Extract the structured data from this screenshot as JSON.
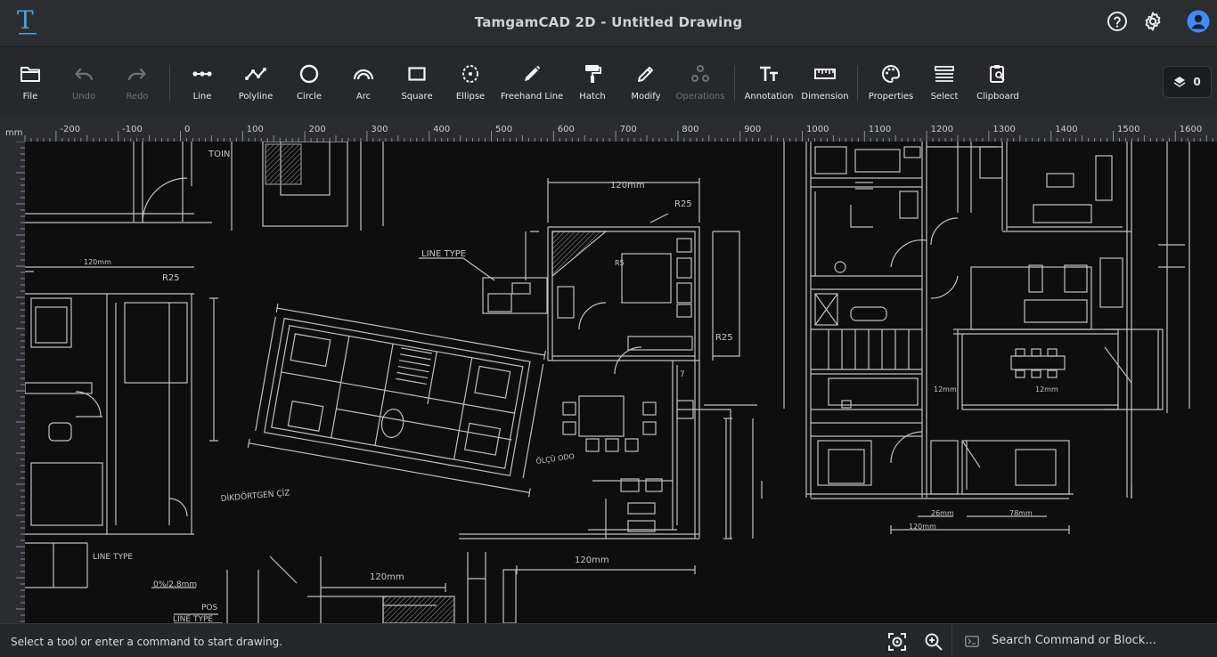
{
  "app": {
    "title": "TamgamCAD 2D - Untitled Drawing",
    "logo_letter": "T"
  },
  "toolbar": {
    "tools": [
      {
        "id": "file",
        "label": "File"
      },
      {
        "id": "undo",
        "label": "Undo"
      },
      {
        "id": "redo",
        "label": "Redo"
      },
      {
        "id": "line",
        "label": "Line"
      },
      {
        "id": "polyline",
        "label": "Polyline"
      },
      {
        "id": "circle",
        "label": "Circle"
      },
      {
        "id": "arc",
        "label": "Arc"
      },
      {
        "id": "square",
        "label": "Square"
      },
      {
        "id": "ellipse",
        "label": "Ellipse"
      },
      {
        "id": "freehand",
        "label": "Freehand Line"
      },
      {
        "id": "hatch",
        "label": "Hatch"
      },
      {
        "id": "modify",
        "label": "Modify"
      },
      {
        "id": "operations",
        "label": "Operations"
      },
      {
        "id": "annotation",
        "label": "Annotation"
      },
      {
        "id": "dimension",
        "label": "Dimension"
      },
      {
        "id": "properties",
        "label": "Properties"
      },
      {
        "id": "select",
        "label": "Select"
      },
      {
        "id": "clipboard",
        "label": "Clipboard"
      }
    ],
    "layer_count": "0"
  },
  "ruler": {
    "unit": "mm",
    "ticks": [
      "-200",
      "-100",
      "0",
      "100",
      "200",
      "300",
      "400",
      "500",
      "600",
      "700",
      "800",
      "900",
      "1000",
      "1100",
      "1200",
      "1300",
      "1400",
      "1500",
      "1600"
    ]
  },
  "drawing_labels": {
    "toin": "TOIN",
    "dim_120_top": "120mm",
    "r25_top": "R25",
    "line_type": "LINE TYPE",
    "r25_mid": "R25",
    "r25_small": "R5",
    "dim_120_left": "120mm",
    "r25_left": "R25",
    "dikdortgen": "DİKDÖRTGEN ÇİZ",
    "olcu": "ÖLÇÜ ODO",
    "dim_120_bottom": "120mm",
    "dim_120_bottom_left": "120mm",
    "line_type_bottom": "LINE TYPE",
    "pos": "POS",
    "line_type_bottom2": "LINE TYPE",
    "scale": "0%/2.8mm",
    "dim_12mm": "12mm",
    "dim_12mm_b": "12mm",
    "dim_26mm": "26mm",
    "dim_78mm": "78mm",
    "dim_120mm_right": "120mm",
    "num_7": "7"
  },
  "status": {
    "message": "Select a tool or enter a command to start drawing.",
    "command_placeholder": "Search Command or Block..."
  },
  "colors": {
    "titlebar": "#2b2d31",
    "toolbar": "#26282c",
    "canvas": "#0e0e0f",
    "accent_user": "#3d8bfd",
    "logo": "#4aa3df"
  }
}
